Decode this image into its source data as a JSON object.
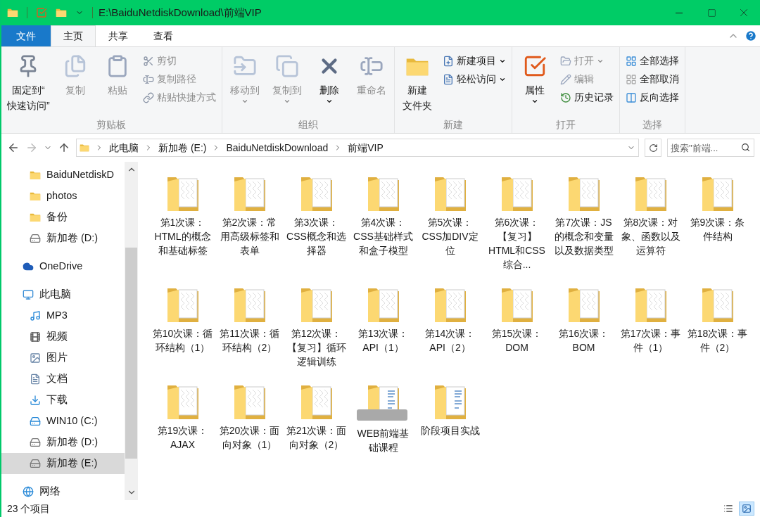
{
  "window": {
    "title": "E:\\BaiduNetdiskDownload\\前端VIP"
  },
  "ribbon_tabs": [
    {
      "label": "文件",
      "kind": "file",
      "selected": false
    },
    {
      "label": "主页",
      "kind": "tab",
      "selected": true
    },
    {
      "label": "共享",
      "kind": "tab",
      "selected": false
    },
    {
      "label": "查看",
      "kind": "tab",
      "selected": false
    }
  ],
  "ribbon_groups": [
    {
      "label": "剪贴板",
      "items": [
        {
          "kind": "large",
          "lines": [
            "固定到“",
            "快速访问”"
          ],
          "disabled": false,
          "dropdown": false
        },
        {
          "kind": "large",
          "lines": [
            "复制"
          ],
          "disabled": true,
          "dropdown": false
        },
        {
          "kind": "large",
          "lines": [
            "粘贴"
          ],
          "disabled": true,
          "dropdown": false
        },
        {
          "kind": "small",
          "lines": [
            "剪切"
          ],
          "disabled": true,
          "dropdown": false
        },
        {
          "kind": "small",
          "lines": [
            "复制路径"
          ],
          "disabled": true,
          "dropdown": false
        },
        {
          "kind": "small",
          "lines": [
            "粘贴快捷方式"
          ],
          "disabled": true,
          "dropdown": false
        }
      ]
    },
    {
      "label": "组织",
      "items": [
        {
          "kind": "large",
          "lines": [
            "移动到"
          ],
          "disabled": true,
          "dropdown": true
        },
        {
          "kind": "large",
          "lines": [
            "复制到"
          ],
          "disabled": true,
          "dropdown": true
        },
        {
          "kind": "large",
          "lines": [
            "删除"
          ],
          "disabled": false,
          "dropdown": true
        },
        {
          "kind": "large",
          "lines": [
            "重命名"
          ],
          "disabled": true,
          "dropdown": false
        }
      ]
    },
    {
      "label": "新建",
      "items": [
        {
          "kind": "large",
          "lines": [
            "新建",
            "文件夹"
          ],
          "disabled": false,
          "dropdown": false
        },
        {
          "kind": "small",
          "lines": [
            "新建项目"
          ],
          "disabled": false,
          "dropdown": true
        },
        {
          "kind": "small",
          "lines": [
            "轻松访问"
          ],
          "disabled": false,
          "dropdown": true
        }
      ]
    },
    {
      "label": "打开",
      "items": [
        {
          "kind": "large",
          "lines": [
            "属性"
          ],
          "disabled": false,
          "dropdown": true
        },
        {
          "kind": "small",
          "lines": [
            "打开"
          ],
          "disabled": true,
          "dropdown": true
        },
        {
          "kind": "small",
          "lines": [
            "编辑"
          ],
          "disabled": true,
          "dropdown": false
        },
        {
          "kind": "small",
          "lines": [
            "历史记录"
          ],
          "disabled": false,
          "dropdown": false
        }
      ]
    },
    {
      "label": "选择",
      "items": [
        {
          "kind": "small",
          "lines": [
            "全部选择"
          ],
          "disabled": false,
          "dropdown": false
        },
        {
          "kind": "small",
          "lines": [
            "全部取消"
          ],
          "disabled": false,
          "dropdown": false
        },
        {
          "kind": "small",
          "lines": [
            "反向选择"
          ],
          "disabled": false,
          "dropdown": false
        }
      ]
    }
  ],
  "address": {
    "breadcrumbs": [
      "此电脑",
      "新加卷 (E:)",
      "BaiduNetdiskDownload",
      "前端VIP"
    ]
  },
  "search": {
    "placeholder": "搜索\"前端..."
  },
  "sidebar": {
    "pinned": [
      {
        "label": "BaiduNetdiskD",
        "kind": "folder",
        "selected": false
      },
      {
        "label": "photos",
        "kind": "folder",
        "selected": false
      },
      {
        "label": "备份",
        "kind": "folder",
        "selected": false
      },
      {
        "label": "新加卷 (D:)",
        "kind": "drive",
        "selected": false
      }
    ],
    "roots": [
      {
        "label": "OneDrive",
        "kind": "cloud",
        "selected": false
      },
      {
        "label": "此电脑",
        "kind": "computer",
        "selected": false,
        "children": [
          {
            "label": "MP3",
            "kind": "music",
            "selected": false
          },
          {
            "label": "视频",
            "kind": "video",
            "selected": false
          },
          {
            "label": "图片",
            "kind": "picture",
            "selected": false
          },
          {
            "label": "文档",
            "kind": "document",
            "selected": false
          },
          {
            "label": "下载",
            "kind": "download",
            "selected": false
          },
          {
            "label": "WIN10 (C:)",
            "kind": "system",
            "selected": false
          },
          {
            "label": "新加卷 (D:)",
            "kind": "drive",
            "selected": false
          },
          {
            "label": "新加卷 (E:)",
            "kind": "drive",
            "selected": true
          }
        ]
      },
      {
        "label": "网络",
        "kind": "network",
        "selected": false
      }
    ]
  },
  "folders": [
    {
      "label": "第1次课：HTML的概念和基础标签",
      "kind": "plain"
    },
    {
      "label": "第2次课：常用高级标签和表单",
      "kind": "plain"
    },
    {
      "label": "第3次课：CSS概念和选择器",
      "kind": "plain"
    },
    {
      "label": "第4次课：CSS基础样式和盒子模型",
      "kind": "plain"
    },
    {
      "label": "第5次课：CSS加DIV定位",
      "kind": "plain"
    },
    {
      "label": "第6次课：【复习】HTML和CSS综合...",
      "kind": "plain"
    },
    {
      "label": "第7次课：JS的概念和变量以及数据类型",
      "kind": "plain"
    },
    {
      "label": "第8次课：对象、函数以及运算符",
      "kind": "plain"
    },
    {
      "label": "第9次课：条件结构",
      "kind": "plain"
    },
    {
      "label": "第10次课：循环结构（1）",
      "kind": "plain"
    },
    {
      "label": "第11次课：循环结构（2）",
      "kind": "plain"
    },
    {
      "label": "第12次课：【复习】循环逻辑训练",
      "kind": "plain"
    },
    {
      "label": "第13次课：API（1）",
      "kind": "plain"
    },
    {
      "label": "第14次课：API（2）",
      "kind": "plain"
    },
    {
      "label": "第15次课：DOM",
      "kind": "plain"
    },
    {
      "label": "第16次课：BOM",
      "kind": "plain"
    },
    {
      "label": "第17次课：事件（1）",
      "kind": "plain"
    },
    {
      "label": "第18次课：事件（2）",
      "kind": "plain"
    },
    {
      "label": "第19次课：AJAX",
      "kind": "plain"
    },
    {
      "label": "第20次课：面向对象（1）",
      "kind": "plain"
    },
    {
      "label": "第21次课：面向对象（2）",
      "kind": "plain"
    },
    {
      "label": "WEB前端基础课程",
      "kind": "blurred"
    },
    {
      "label": "阶段项目实战",
      "kind": "docs"
    }
  ],
  "status_bar": {
    "count": "23 个项目",
    "views": [
      {
        "kind": "details",
        "selected": false
      },
      {
        "kind": "large-icons",
        "selected": true
      }
    ]
  }
}
